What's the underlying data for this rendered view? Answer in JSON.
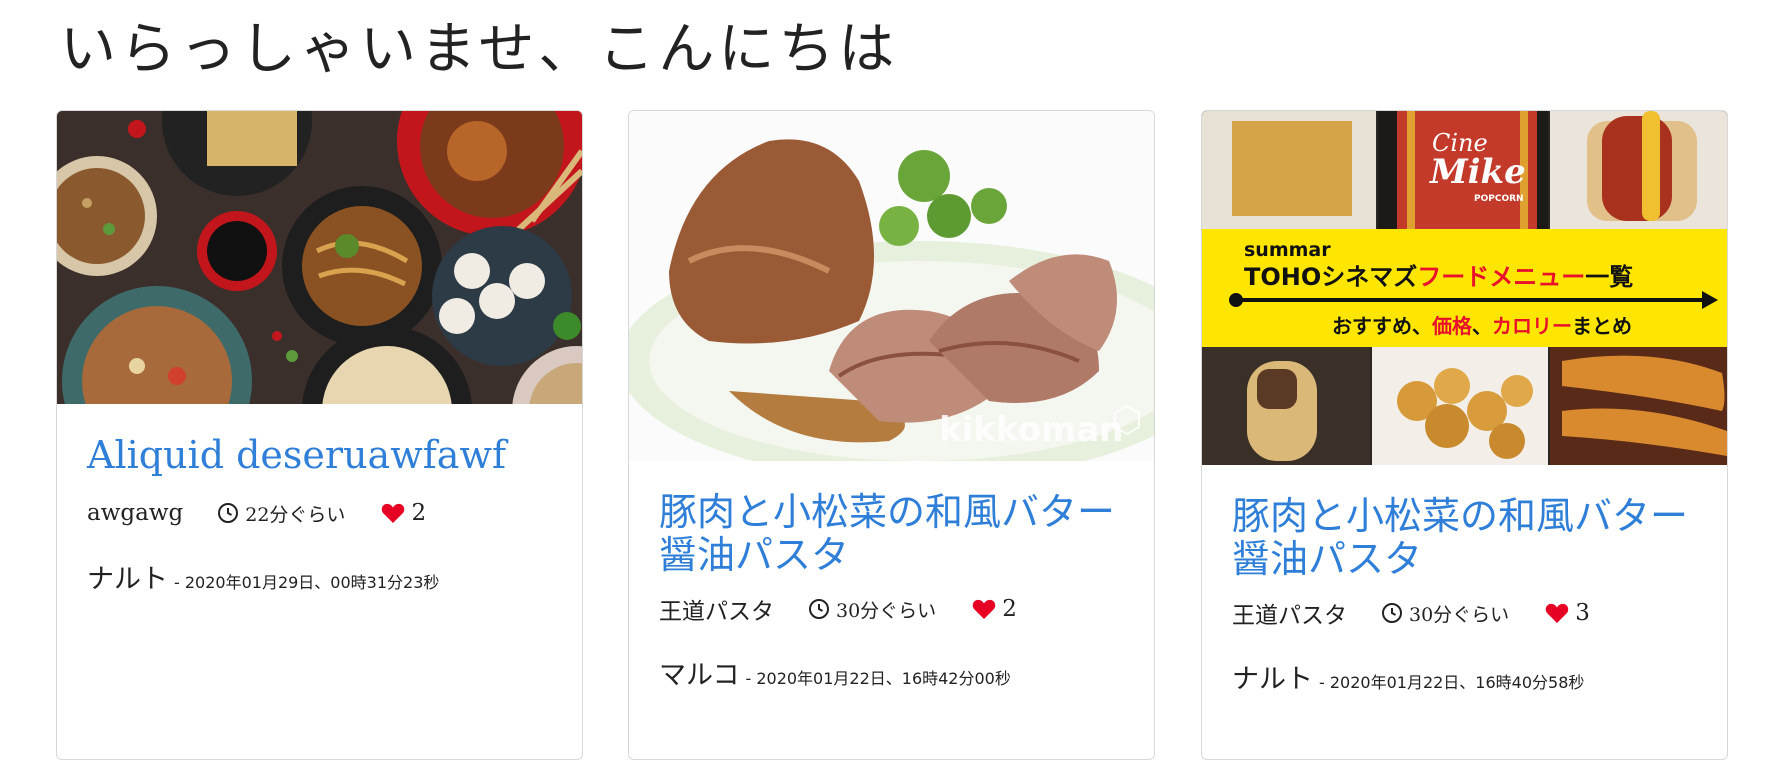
{
  "page": {
    "title": "いらっしゃいませ、こんにちは"
  },
  "colors": {
    "link": "#2f7fd9",
    "heart": "#e60023",
    "border": "#d8d8d8"
  },
  "cards": [
    {
      "image": "chinese-food-spread-photo",
      "title": "Aliquid deseruawfawf",
      "category": "awgawg",
      "time": "22分ぐらい",
      "likes": "2",
      "author": "ナルト",
      "date": "- 2020年01月29日、00時31分23秒"
    },
    {
      "image": "braised-pork-photo",
      "image_watermark": "kikkoman",
      "title": "豚肉と小松菜の和風バター醤油パスタ",
      "category": "王道パスタ",
      "time": "30分ぐらい",
      "likes": "2",
      "author": "マルコ",
      "date": "- 2020年01月22日、16時42分00秒"
    },
    {
      "image": "toho-cinemas-food-menu-banner",
      "banner": {
        "brand": "summar",
        "headline_part1": "TOHOシネマズ",
        "headline_part2": "フードメニュー",
        "headline_part3": "一覧",
        "sub_part1": "おすすめ、",
        "sub_part2": "価格",
        "sub_part3": "、",
        "sub_part4": "カロリー",
        "sub_part5": "まとめ",
        "bag_text1": "Cine",
        "bag_text2": "Mike",
        "bag_text3": "POPCORN"
      },
      "title": "豚肉と小松菜の和風バター醤油パスタ",
      "category": "王道パスタ",
      "time": "30分ぐらい",
      "likes": "3",
      "author": "ナルト",
      "date": "- 2020年01月22日、16時40分58秒"
    }
  ]
}
